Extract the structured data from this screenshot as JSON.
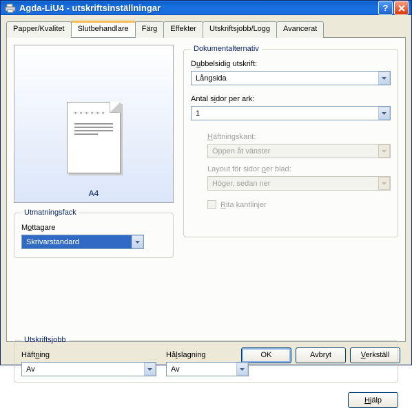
{
  "window": {
    "title": "Agda-LiU4 - utskriftsinställningar"
  },
  "tabs": {
    "paper": "Papper/Kvalitet",
    "finishing": "Slutbehandlare",
    "color": "Färg",
    "effects": "Effekter",
    "jobs": "Utskriftsjobb/Logg",
    "advanced": "Avancerat"
  },
  "preview": {
    "format": "A4"
  },
  "output_tray": {
    "legend": "Utmatningsfack",
    "label_pre": "M",
    "label_u": "o",
    "label_post": "ttagare",
    "value": "Skrivarstandard"
  },
  "doc_options": {
    "legend": "Dokumentalternativ",
    "duplex": {
      "label_pre": "D",
      "label_u": "u",
      "label_post": "bbelsidig utskrift:",
      "value": "Långsida"
    },
    "pages_per_sheet": {
      "label_pre": "Antal s",
      "label_u": "i",
      "label_post": "dor per ark:",
      "value": "1"
    },
    "staple_edge": {
      "label_pre": "",
      "label_u": "H",
      "label_post": "äftningskant:",
      "value": "Öppen åt vänster"
    },
    "layout": {
      "label_pre": "Layout för sidor ",
      "label_u": "p",
      "label_post": "er blad:",
      "value": "Höger, sedan ner"
    },
    "borders": {
      "label_pre": "",
      "label_u": "R",
      "label_post": "ita kantlinjer"
    }
  },
  "print_job": {
    "legend": "Utskriftsjobb",
    "stapling": {
      "label_pre": "Häft",
      "label_u": "n",
      "label_post": "ing",
      "value": "Av"
    },
    "punching": {
      "label_pre": "Hå",
      "label_u": "l",
      "label_post": "slagning",
      "value": "Av"
    }
  },
  "buttons": {
    "help": "Hjälp",
    "ok": "OK",
    "cancel": "Avbryt",
    "apply": "Verkställ"
  }
}
